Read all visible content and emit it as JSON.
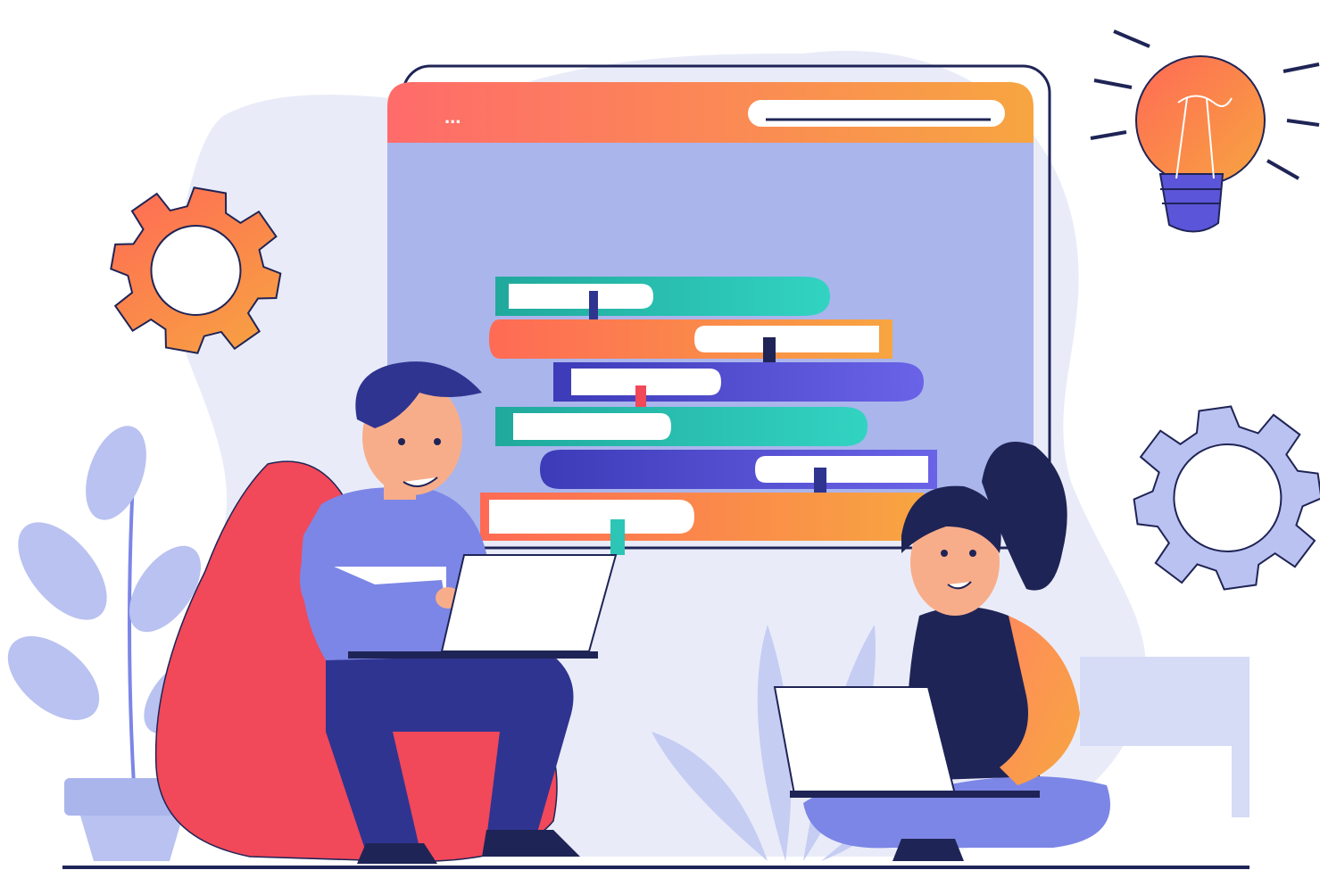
{
  "illustration": {
    "browser_window": {
      "menu_dots": "...",
      "has_address_bar": true
    },
    "elements": [
      "gear-left-icon",
      "gear-right-icon",
      "lightbulb-icon",
      "book-stack",
      "man-on-beanbag-with-laptop",
      "woman-sitting-with-laptop",
      "potted-plant",
      "leafy-plant-center"
    ]
  },
  "colors": {
    "blob": "#e9ecf8",
    "window_frame": "#1f2456",
    "window_bar_left": "#ff6b6b",
    "window_bar_right": "#f7a541",
    "window_body": "#aab5ec",
    "teal": "#2cc5b6",
    "coral": "#ff6a55",
    "orange": "#f7a541",
    "indigo": "#5b55d9",
    "navy": "#1f2456",
    "beanbag": "#f1485a",
    "sweater": "#7c86e6",
    "pants": "#2f3490",
    "skin": "#f8ad8a",
    "light_periwinkle": "#b9c2f0"
  }
}
